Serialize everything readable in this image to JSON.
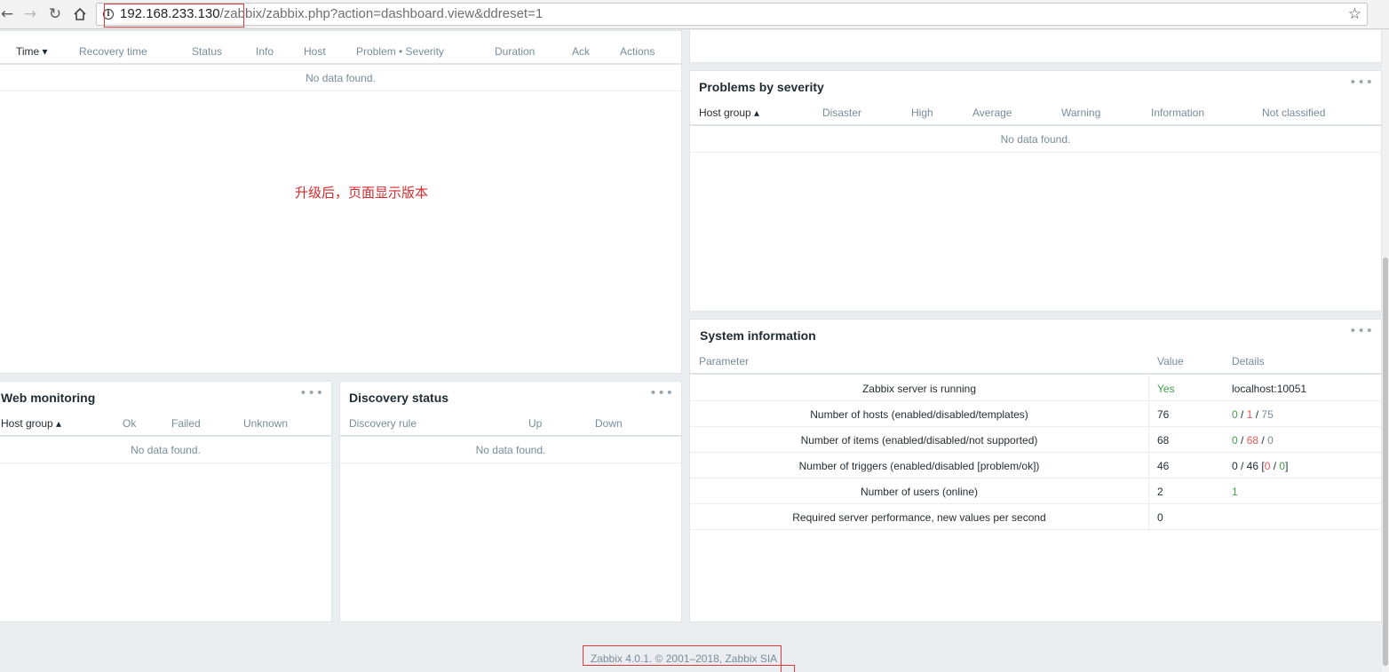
{
  "browser": {
    "url_host": "192.168.233.130",
    "url_rest": "/zabbix/zabbix.php?action=dashboard.view&ddreset=1"
  },
  "problems": {
    "headers": [
      "Time ▾",
      "Recovery time",
      "Status",
      "Info",
      "Host",
      "Problem • Severity",
      "Duration",
      "Ack",
      "Actions"
    ],
    "no_data": "No data found."
  },
  "annotation": "升级后，页面显示版本",
  "severity": {
    "title": "Problems by severity",
    "headers": [
      "Host group ▴",
      "Disaster",
      "High",
      "Average",
      "Warning",
      "Information",
      "Not classified"
    ],
    "no_data": "No data found."
  },
  "web": {
    "title": "Web monitoring",
    "headers": [
      "Host group ▴",
      "Ok",
      "Failed",
      "Unknown"
    ],
    "no_data": "No data found."
  },
  "discovery": {
    "title": "Discovery status",
    "headers": [
      "Discovery rule",
      "Up",
      "Down"
    ],
    "no_data": "No data found."
  },
  "sysinfo": {
    "title": "System information",
    "headers": [
      "Parameter",
      "Value",
      "Details"
    ],
    "rows": [
      {
        "param": "Zabbix server is running",
        "value": "Yes",
        "d1": "localhost:10051"
      },
      {
        "param": "Number of hosts (enabled/disabled/templates)",
        "value": "76",
        "d1": "0",
        "s1": " / ",
        "d2": "1",
        "s2": " / ",
        "d3": "75"
      },
      {
        "param": "Number of items (enabled/disabled/not supported)",
        "value": "68",
        "d1": "0",
        "s1": " / ",
        "d2": "68",
        "s2": " / ",
        "d3": "0"
      },
      {
        "param": "Number of triggers (enabled/disabled [problem/ok])",
        "value": "46",
        "d1": "0 / 46 [",
        "d2": "0",
        "s2": " / ",
        "d3": "0",
        "s3": "]"
      },
      {
        "param": "Number of users (online)",
        "value": "2",
        "d1": "1"
      },
      {
        "param": "Required server performance, new values per second",
        "value": "0"
      }
    ]
  },
  "footer": "Zabbix 4.0.1. © 2001–2018, Zabbix SIA",
  "colors": {
    "ok_green": "#429e47",
    "problem_red": "#e45959",
    "highlight": "#e03a3a"
  }
}
